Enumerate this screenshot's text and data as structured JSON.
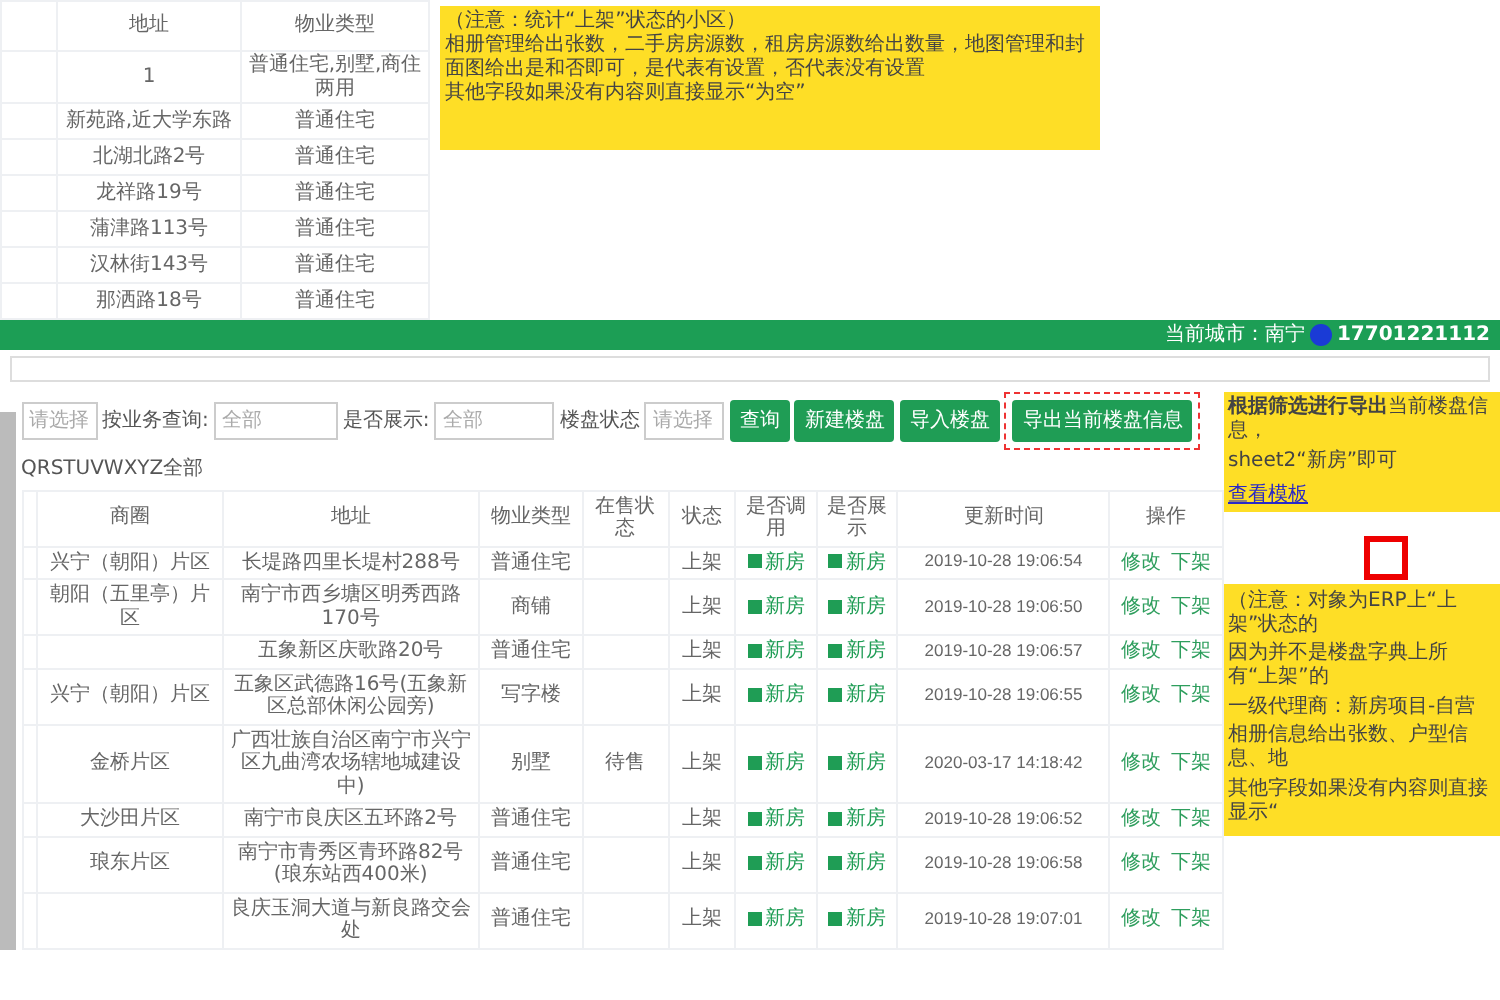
{
  "top_table": {
    "columns": [
      "地址",
      "物业类型"
    ],
    "rows": [
      [
        "1",
        "普通住宅,别墅,商住两用"
      ],
      [
        "新苑路,近大学东路",
        "普通住宅"
      ],
      [
        "北湖北路2号",
        "普通住宅"
      ],
      [
        "龙祥路19号",
        "普通住宅"
      ],
      [
        "蒲津路113号",
        "普通住宅"
      ],
      [
        "汉林街143号",
        "普通住宅"
      ],
      [
        "那洒路18号",
        "普通住宅"
      ]
    ]
  },
  "top_note": {
    "lines": [
      "（注意：统计“上架”状态的小区）",
      "相册管理给出张数，二手房房源数，租房房源数给出数量，地图管理和封面图给出是和否即可，是代表有设置，否代表没有设置",
      "其他字段如果没有内容则直接显示“为空”"
    ]
  },
  "header": {
    "city": "当前城市：南宁",
    "phone": "17701221112"
  },
  "filters": [
    {
      "kind": "select",
      "value": "请选择"
    },
    {
      "kind": "label",
      "text": "按业务查询:"
    },
    {
      "kind": "select",
      "value": "全部"
    },
    {
      "kind": "label",
      "text": "是否展示:"
    },
    {
      "kind": "select",
      "value": "全部"
    },
    {
      "kind": "label",
      "text": "楼盘状态"
    },
    {
      "kind": "select",
      "value": "请选择"
    }
  ],
  "buttons": [
    {
      "label": "查询",
      "highlighted": false
    },
    {
      "label": "新建楼盘",
      "highlighted": false
    },
    {
      "label": "导入楼盘",
      "highlighted": false
    },
    {
      "label": "导出当前楼盘信息",
      "highlighted": true
    }
  ],
  "letter_filter": "QRSTUVWXYZ全部",
  "table": {
    "columns": [
      "商圈",
      "地址",
      "物业类型",
      "在售状态",
      "状态",
      "是否调用",
      "是否展示",
      "更新时间",
      "操作"
    ],
    "rows": [
      {
        "district": "兴宁（朝阳）片区",
        "address": "长堤路四里长堤村288号",
        "type": "普通住宅",
        "status": "上架",
        "use": {
          "label": "新房",
          "checked": true
        },
        "show": {
          "label": "新房",
          "checked": true
        },
        "updated": "2019-10-28 19:06:54",
        "actions": [
          "修改",
          "下架"
        ]
      },
      {
        "district": "朝阳（五里亭）片区",
        "address": "南宁市西乡塘区明秀西路170号",
        "type": "商铺",
        "status": "上架",
        "use": {
          "label": "新房",
          "checked": true
        },
        "show": {
          "label": "新房",
          "checked": true
        },
        "updated": "2019-10-28 19:06:50",
        "actions": [
          "修改",
          "下架"
        ]
      },
      {
        "address": "五象新区庆歌路20号",
        "type": "普通住宅",
        "status": "上架",
        "use": {
          "label": "新房",
          "checked": true
        },
        "show": {
          "label": "新房",
          "checked": true
        },
        "updated": "2019-10-28 19:06:57",
        "actions": [
          "修改",
          "下架"
        ]
      },
      {
        "district": "兴宁（朝阳）片区",
        "address": "五象区武德路16号(五象新区总部休闲公园旁)",
        "type": "写字楼",
        "status": "上架",
        "use": {
          "label": "新房",
          "checked": true
        },
        "show": {
          "label": "新房",
          "checked": true
        },
        "updated": "2019-10-28 19:06:55",
        "actions": [
          "修改",
          "下架"
        ]
      },
      {
        "district": "金桥片区",
        "address": "广西壮族自治区南宁市兴宁区九曲湾农场辖地城建设中)",
        "type": "别墅",
        "sale_status": "待售",
        "status": "上架",
        "use": {
          "label": "新房",
          "checked": true
        },
        "show": {
          "label": "新房",
          "checked": true
        },
        "updated": "2020-03-17 14:18:42",
        "actions": [
          "修改",
          "下架"
        ]
      },
      {
        "district": "大沙田片区",
        "address": "南宁市良庆区五环路2号",
        "type": "普通住宅",
        "status": "上架",
        "use": {
          "label": "新房",
          "checked": true
        },
        "show": {
          "label": "新房",
          "checked": true
        },
        "updated": "2019-10-28 19:06:52",
        "actions": [
          "修改",
          "下架"
        ]
      },
      {
        "district": "琅东片区",
        "address": "南宁市青秀区青环路82号(琅东站西400米)",
        "type": "普通住宅",
        "status": "上架",
        "use": {
          "label": "新房",
          "checked": true
        },
        "show": {
          "label": "新房",
          "checked": true
        },
        "updated": "2019-10-28 19:06:58",
        "actions": [
          "修改",
          "下架"
        ]
      },
      {
        "address": "良庆玉洞大道与新良路交会处",
        "type": "普通住宅",
        "status": "上架",
        "use": {
          "label": "新房",
          "checked": true
        },
        "show": {
          "label": "新房",
          "checked": true
        },
        "updated": "2019-10-28 19:07:01",
        "actions": [
          "修改",
          "下架"
        ]
      }
    ]
  },
  "notes": [
    {
      "lines": [
        "**根据筛选进行导出**当前楼盘信息，",
        "sheet2“新房”即可"
      ],
      "link": "查看模板"
    },
    {
      "lines": [
        "（注意：对象为ERP上“上架”状态的",
        "因为并不是楼盘字典上所有“上架”的",
        "一级代理商：新房项目-自营",
        "相册信息给出张数、户型信息、地",
        "其他字段如果没有内容则直接显示“"
      ]
    }
  ]
}
